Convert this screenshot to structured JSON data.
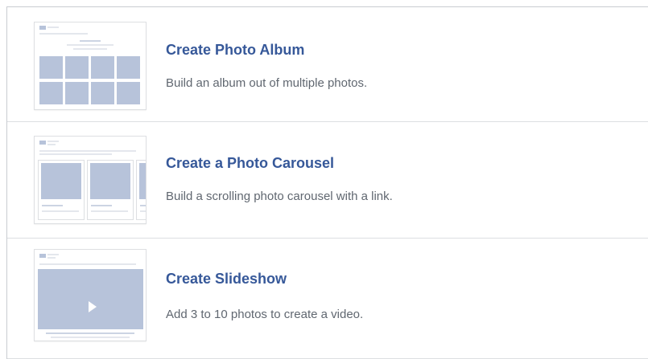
{
  "options": [
    {
      "title": "Create Photo Album",
      "description": "Build an album out of multiple photos.",
      "thumbnail_icon": "photo-album-preview"
    },
    {
      "title": "Create a Photo Carousel",
      "description": "Build a scrolling photo carousel with a link.",
      "thumbnail_icon": "photo-carousel-preview"
    },
    {
      "title": "Create Slideshow",
      "description": "Add 3 to 10 photos to create a video.",
      "thumbnail_icon": "slideshow-preview"
    }
  ],
  "colors": {
    "title": "#365899",
    "description": "#606770",
    "placeholder": "#b7c3da",
    "divider": "#dddfe2"
  }
}
